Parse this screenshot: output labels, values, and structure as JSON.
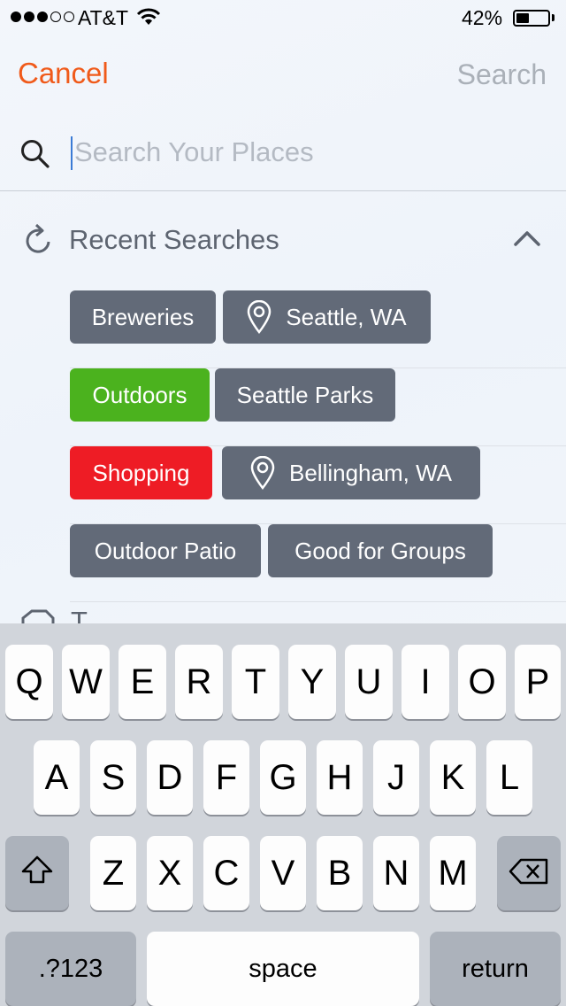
{
  "status_bar": {
    "carrier": "AT&T",
    "battery_percent": "42%",
    "signal_bars_filled": 3,
    "signal_bars_total": 5,
    "battery_level": 0.42
  },
  "nav": {
    "cancel_label": "Cancel",
    "search_label": "Search"
  },
  "search": {
    "placeholder": "Search Your Places",
    "value": ""
  },
  "recent": {
    "title": "Recent Searches",
    "tags": {
      "breweries": "Breweries",
      "seattle": "Seattle, WA",
      "outdoors": "Outdoors",
      "seattle_parks": "Seattle Parks",
      "shopping": "Shopping",
      "bellingham": "Bellingham, WA",
      "outdoor_patio": "Outdoor Patio",
      "good_for_groups": "Good for Groups"
    }
  },
  "partial_section": {
    "label_fragment": "T"
  },
  "keyboard": {
    "row1": [
      "Q",
      "W",
      "E",
      "R",
      "T",
      "Y",
      "U",
      "I",
      "O",
      "P"
    ],
    "row2": [
      "A",
      "S",
      "D",
      "F",
      "G",
      "H",
      "J",
      "K",
      "L"
    ],
    "row3": [
      "Z",
      "X",
      "C",
      "V",
      "B",
      "N",
      "M"
    ],
    "numbers_label": ".?123",
    "space_label": "space",
    "return_label": "return"
  },
  "colors": {
    "accent": "#f05a1a",
    "tag_default": "#626a78",
    "tag_green": "#4bb21e",
    "tag_red": "#ee1c25"
  }
}
